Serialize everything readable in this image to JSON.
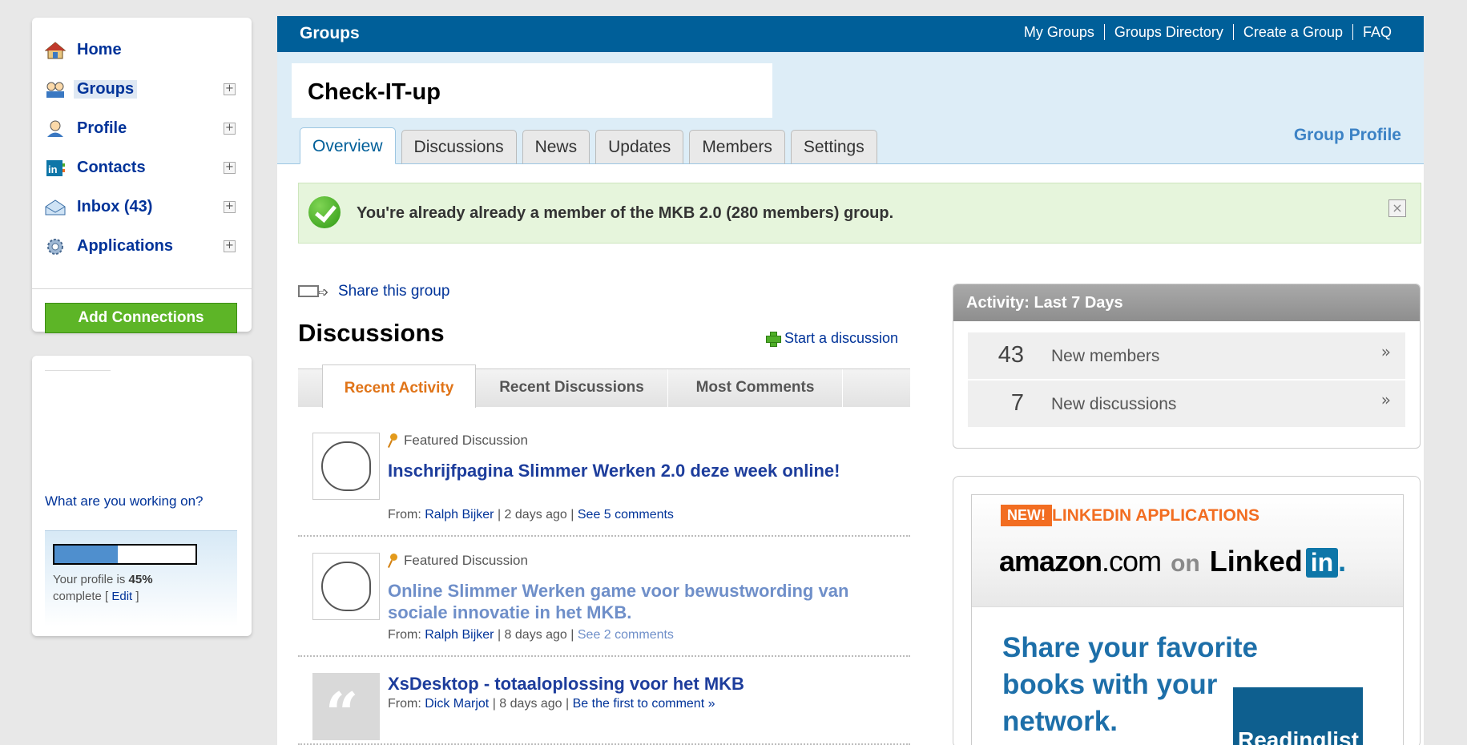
{
  "sidebar": {
    "items": [
      {
        "label": "Home",
        "icon": "home-icon",
        "expandable": false,
        "active": false
      },
      {
        "label": "Groups",
        "icon": "groups-icon",
        "expandable": true,
        "active": true
      },
      {
        "label": "Profile",
        "icon": "profile-icon",
        "expandable": true,
        "active": false
      },
      {
        "label": "Contacts",
        "icon": "contacts-icon",
        "expandable": true,
        "active": false
      },
      {
        "label": "Inbox (43)",
        "icon": "inbox-icon",
        "expandable": true,
        "active": false
      },
      {
        "label": "Applications",
        "icon": "applications-icon",
        "expandable": true,
        "active": false
      }
    ],
    "expand_symbol": "+",
    "add_connections_label": "Add Connections",
    "working_on_link": "What are you working on?",
    "profile_complete_percent": 45,
    "profile_text_prefix": "Your profile is",
    "profile_percent_label": "45%",
    "profile_text_suffix": "complete [",
    "profile_edit_label": "Edit",
    "profile_text_close": "]"
  },
  "topbar": {
    "section_title": "Groups",
    "links": [
      "My Groups",
      "Groups Directory",
      "Create a Group",
      "FAQ"
    ]
  },
  "group": {
    "name": "Check-IT-up",
    "tabs": [
      "Overview",
      "Discussions",
      "News",
      "Updates",
      "Members",
      "Settings"
    ],
    "active_tab": "Overview",
    "profile_link": "Group Profile"
  },
  "notice": {
    "text": "You're already already a member of the MKB 2.0 (280 members) group.",
    "close_symbol": "×"
  },
  "share": {
    "label": "Share this group"
  },
  "discussions": {
    "title": "Discussions",
    "start_label": "Start a discussion",
    "tabs": [
      "Recent Activity",
      "Recent Discussions",
      "Most Comments"
    ],
    "active_tab": "Recent Activity",
    "featured_label": "Featured Discussion",
    "items": [
      {
        "featured": true,
        "title": "Inschrijfpagina Slimmer Werken 2.0 deze week online!",
        "from_label": "From:",
        "author": "Ralph Bijker",
        "time": "2 days ago",
        "comments": "See 5 comments"
      },
      {
        "featured": true,
        "title": "Online Slimmer Werken game voor bewustwording van sociale innovatie in het MKB.",
        "from_label": "From:",
        "author": "Ralph Bijker",
        "time": "8 days ago",
        "comments": "See 2 comments"
      },
      {
        "featured": false,
        "title": "XsDesktop - totaaloplossing voor het MKB",
        "from_label": "From:",
        "author": "Dick Marjot",
        "time": "8 days ago",
        "comments": "Be the first to comment »"
      }
    ]
  },
  "activity": {
    "title": "Activity: Last 7 Days",
    "rows": [
      {
        "count": "43",
        "label": "New members",
        "arrow": "»"
      },
      {
        "count": "7",
        "label": "New discussions",
        "arrow": "»"
      }
    ]
  },
  "apps_ad": {
    "badge": "NEW!",
    "title": "LINKEDIN APPLICATIONS",
    "amazon_main": "amazon",
    "amazon_com": ".com",
    "on": "on",
    "linked": "Linked",
    "in": "in",
    "dot": ".",
    "headline": "Share your favorite books with your network.",
    "reading_list": "Readinglist"
  },
  "colors": {
    "brand_blue": "#005f99",
    "header_bg": "#ddedf7",
    "success_bg": "#e6f5dc",
    "button_green": "#5db527",
    "link_blue": "#003399",
    "accent_orange": "#f26d21"
  }
}
